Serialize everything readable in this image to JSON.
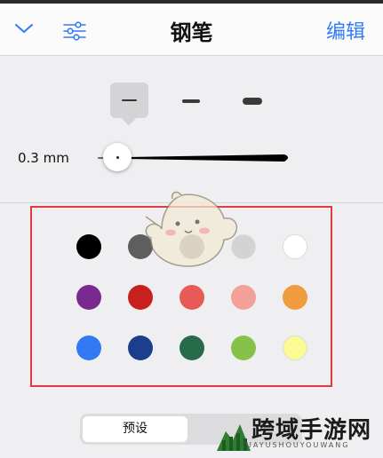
{
  "header": {
    "title": "钢笔",
    "edit_label": "编辑"
  },
  "pen": {
    "size_label": "0.3 mm"
  },
  "colors": [
    "#000000",
    "#5e5e5e",
    "#9a9a9a",
    "#d3d3d3",
    "#ffffff",
    "#7a2a8f",
    "#c8211d",
    "#e85a55",
    "#f3a09b",
    "#ee9c3e",
    "#3379f4",
    "#1c3e8c",
    "#266b4a",
    "#86c24a",
    "#fbfa93"
  ],
  "segment": {
    "preset_label": "预设"
  },
  "watermark": {
    "text": "跨域手游网",
    "subtext": "KUAYUSHOUYOUWANG"
  },
  "icons": {
    "collapse": "chevron-down-icon",
    "settings": "sliders-icon"
  },
  "accent_color": "#2f7cf6",
  "highlight_color": "#e23b3b"
}
